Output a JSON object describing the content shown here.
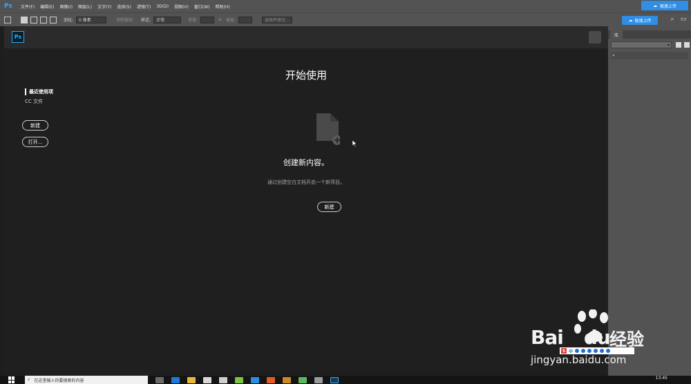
{
  "menubar": {
    "logo": "Ps",
    "items": [
      "文件(F)",
      "编辑(E)",
      "图像(I)",
      "图层(L)",
      "文字(Y)",
      "选择(S)",
      "滤镜(T)",
      "3D(D)",
      "视图(V)",
      "窗口(W)",
      "帮助(H)"
    ],
    "upload_label": "极速上传"
  },
  "optbar": {
    "feather_label": "羽化:",
    "feather_value": "0 像素",
    "antialias_label": "消除锯齿",
    "style_label": "样式:",
    "style_value": "正常",
    "width_label": "宽度:",
    "height_label": "高度:",
    "select_mask_label": "选择并遮住...",
    "upload_label": "极速上传"
  },
  "workspace": {
    "logo": "Ps",
    "sidebar": {
      "recent_label": "最近使用项",
      "cc_label": "CC 文件",
      "new_button": "新建",
      "open_button": "打开..."
    },
    "title": "开始使用",
    "create_heading": "创建新内容。",
    "create_desc": "通过创建空白文档开启一个新项目。",
    "center_new_button": "新建"
  },
  "right_panel": {
    "tab_label": "库"
  },
  "taskbar": {
    "search_placeholder": "在这里输入你要搜索的内容",
    "clock": "13:45"
  },
  "watermark": {
    "logo": "Bai",
    "logo_suffix": "du",
    "cn": "经验",
    "url": "jingyan.baidu.com"
  },
  "ime": {
    "letter": "S",
    "label": "中"
  },
  "colors": {
    "accent_blue": "#31a8ff",
    "cloud_button": "#2f8ee5",
    "panel_gray": "#535353",
    "workspace_bg": "#1f1f1f"
  }
}
